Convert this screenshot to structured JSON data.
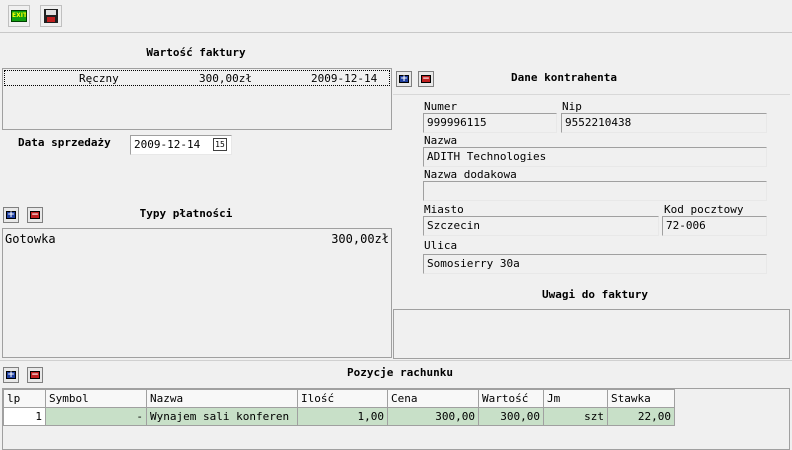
{
  "toolbar": {
    "exit_label": "EXIT"
  },
  "invoice_value": {
    "header": "Wartość faktury",
    "row": {
      "type": "Ręczny",
      "amount": "300,00zł",
      "date": "2009-12-14"
    }
  },
  "sale_date": {
    "label": "Data sprzedaży",
    "value": "2009-12-14",
    "picker_glyph": "15"
  },
  "payment_types": {
    "header": "Typy płatności",
    "row": {
      "name": "Gotowka",
      "amount": "300,00zł"
    }
  },
  "contractor": {
    "header": "Dane kontrahenta",
    "numer_label": "Numer",
    "numer": "999996115",
    "nip_label": "Nip",
    "nip": "9552210438",
    "nazwa_label": "Nazwa",
    "nazwa": "ADITH Technologies",
    "nazwa_dod_label": "Nazwa dodakowa",
    "nazwa_dod": "",
    "miasto_label": "Miasto",
    "miasto": "Szczecin",
    "kod_label": "Kod pocztowy",
    "kod": "72-006",
    "ulica_label": "Ulica",
    "ulica": "Somosierry 30a"
  },
  "notes": {
    "header": "Uwagi do faktury",
    "value": ""
  },
  "items": {
    "header": "Pozycje rachunku",
    "columns": [
      "lp",
      "Symbol",
      "Nazwa",
      "Ilość",
      "Cena",
      "Wartość",
      "Jm",
      "Stawka"
    ],
    "rows": [
      {
        "lp": "1",
        "symbol": "-",
        "nazwa": "Wynajem sali konferen",
        "ilosc": "1,00",
        "cena": "300,00",
        "wartosc": "300,00",
        "jm": "szt",
        "stawka": "22,00"
      }
    ]
  },
  "colors": {
    "accent_blue": "#1f3fa0",
    "accent_red": "#c02020",
    "row_green": "#c8e0c8"
  }
}
